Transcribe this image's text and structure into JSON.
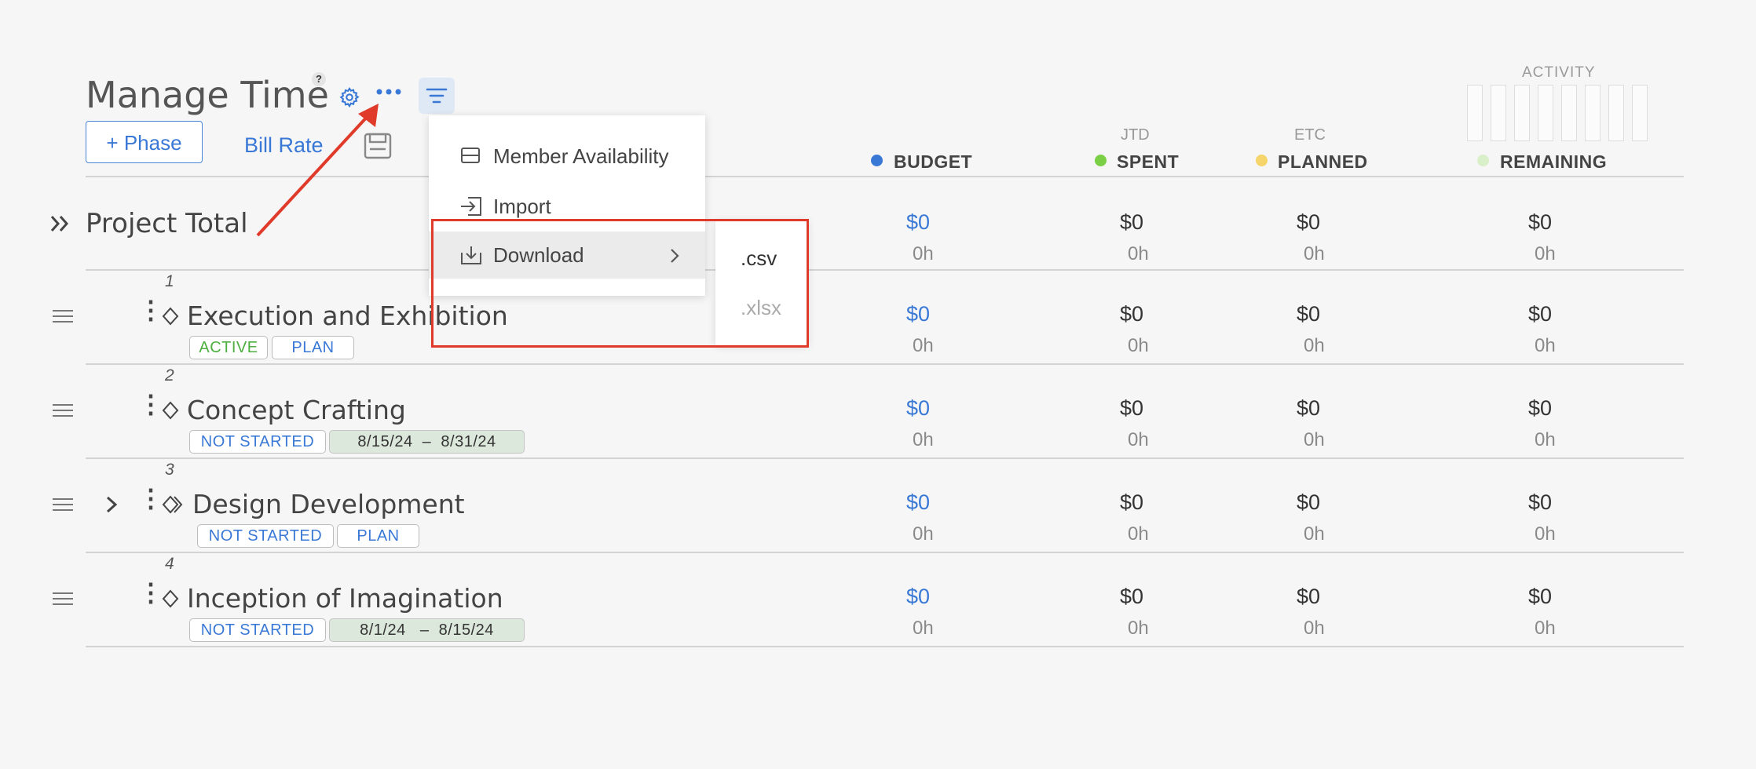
{
  "header": {
    "title": "Manage Time",
    "help": "?",
    "add_phase": "+ Phase",
    "bill_rate": "Bill Rate"
  },
  "columns": {
    "activity": "ACTIVITY",
    "budget": "BUDGET",
    "jtd": "JTD",
    "spent": "SPENT",
    "etc": "ETC",
    "planned": "PLANNED",
    "remaining": "REMAINING",
    "colors": {
      "budget": "#3a78d6",
      "spent": "#7bcf45",
      "planned": "#f5d469",
      "remaining": "#d9efc9"
    }
  },
  "project_total": {
    "label": "Project Total",
    "budget": "$0",
    "budget_h": "0h",
    "spent": "$0",
    "spent_h": "0h",
    "planned": "$0",
    "planned_h": "0h",
    "remaining": "$0",
    "remaining_h": "0h"
  },
  "phases": [
    {
      "index": "1",
      "name": "Execution and Exhibition",
      "badges": [
        "ACTIVE",
        "PLAN"
      ],
      "budget": "$0",
      "budget_h": "0h",
      "spent": "$0",
      "spent_h": "0h",
      "planned": "$0",
      "planned_h": "0h",
      "remaining": "$0",
      "remaining_h": "0h"
    },
    {
      "index": "2",
      "name": "Concept Crafting",
      "badges": [
        "NOT STARTED",
        "8/15/24  –  8/31/24"
      ],
      "budget": "$0",
      "budget_h": "0h",
      "spent": "$0",
      "spent_h": "0h",
      "planned": "$0",
      "planned_h": "0h",
      "remaining": "$0",
      "remaining_h": "0h"
    },
    {
      "index": "3",
      "name": "Design Development",
      "badges": [
        "NOT STARTED",
        "PLAN"
      ],
      "budget": "$0",
      "budget_h": "0h",
      "spent": "$0",
      "spent_h": "0h",
      "planned": "$0",
      "planned_h": "0h",
      "remaining": "$0",
      "remaining_h": "0h"
    },
    {
      "index": "4",
      "name": "Inception of Imagination",
      "badges": [
        "NOT STARTED",
        "8/1/24   –  8/15/24"
      ],
      "budget": "$0",
      "budget_h": "0h",
      "spent": "$0",
      "spent_h": "0h",
      "planned": "$0",
      "planned_h": "0h",
      "remaining": "$0",
      "remaining_h": "0h"
    }
  ],
  "menu": {
    "items": [
      "Member Availability",
      "Import",
      "Download"
    ],
    "submenu": [
      ".csv",
      ".xlsx"
    ]
  },
  "accent_annotation": "#e03b2a"
}
